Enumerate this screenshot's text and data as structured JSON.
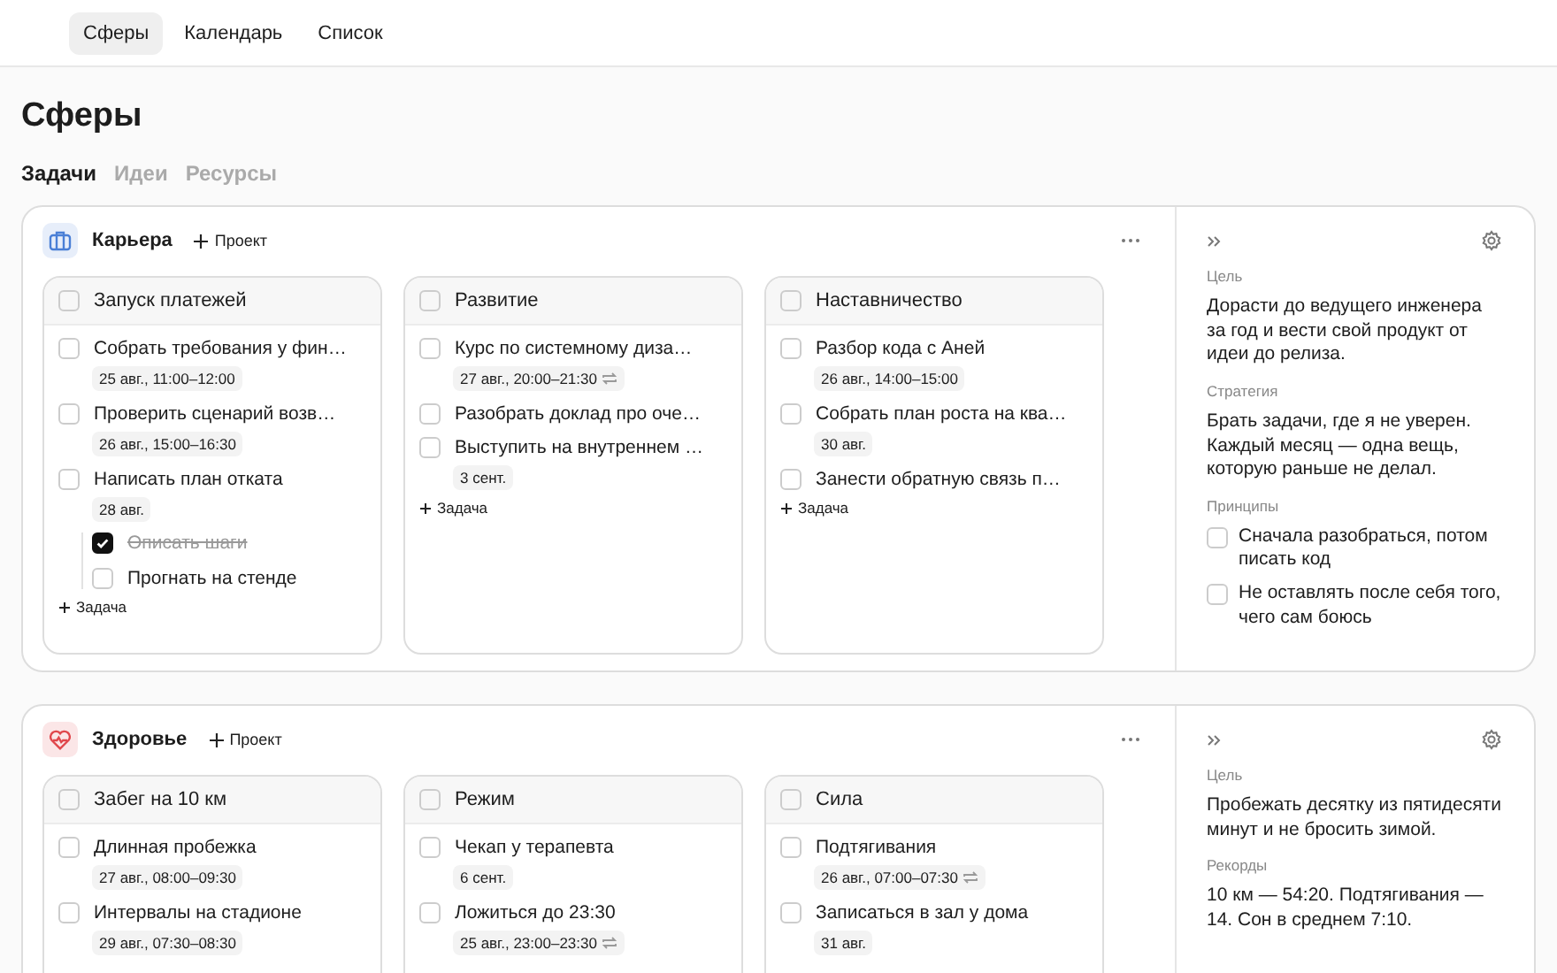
{
  "nav": {
    "tabs": [
      {
        "label": "Сферы",
        "selected": true
      },
      {
        "label": "Календарь",
        "selected": false
      },
      {
        "label": "Список",
        "selected": false
      }
    ]
  },
  "page_title": "Сферы",
  "view_tabs": [
    {
      "label": "Задачи",
      "selected": true
    },
    {
      "label": "Идеи",
      "selected": false
    },
    {
      "label": "Ресурсы",
      "selected": false
    }
  ],
  "spheres": [
    {
      "name": "Карьера",
      "kind": "career",
      "color": "#4a7fd6",
      "add_project": "Проект",
      "projects": [
        {
          "title": "Запуск платежей",
          "checked": false,
          "add_task": "Задача",
          "tasks": [
            {
              "title": "Собрать требования у фин…",
              "checked": false,
              "date": "25 авг., 11:00–12:00",
              "repeat": false
            },
            {
              "title": "Проверить сценарий возв…",
              "checked": false,
              "date": "26 авг., 15:00–16:30",
              "repeat": false
            },
            {
              "title": "Написать план отката",
              "checked": false,
              "date": "28 авг.",
              "repeat": false,
              "children": [
                {
                  "title": "Описать шаги",
                  "checked": true
                },
                {
                  "title": "Прогнать на стенде",
                  "checked": false
                }
              ]
            }
          ]
        },
        {
          "title": "Развитие",
          "checked": false,
          "add_task": "Задача",
          "tasks": [
            {
              "title": "Курс по системному диза…",
              "checked": false,
              "date": "27 авг., 20:00–21:30",
              "repeat": true
            },
            {
              "title": "Разобрать доклад про оче…",
              "checked": false
            },
            {
              "title": "Выступить на внутреннем …",
              "checked": false,
              "date": "3 сент.",
              "repeat": false
            }
          ]
        },
        {
          "title": "Наставничество",
          "checked": false,
          "add_task": "Задача",
          "tasks": [
            {
              "title": "Разбор кода с Аней",
              "checked": false,
              "date": "26 авг., 14:00–15:00",
              "repeat": false
            },
            {
              "title": "Собрать план роста на ква…",
              "checked": false,
              "date": "30 авг.",
              "repeat": false
            },
            {
              "title": "Занести обратную связь п…",
              "checked": false
            }
          ]
        }
      ],
      "panel": [
        {
          "kind": "text",
          "label": "Цель",
          "text": "Дорасти до ведущего инженера за год и вести свой продукт от идеи до релиза."
        },
        {
          "kind": "text",
          "label": "Стратегия",
          "text": "Брать задачи, где я не уверен. Каждый месяц — одна вещь, которую раньше не делал."
        },
        {
          "kind": "checklist",
          "label": "Принципы",
          "items": [
            {
              "text": "Сначала разобраться, потом писать код",
              "checked": false
            },
            {
              "text": "Не оставлять после себя того, чего сам боюсь",
              "checked": false
            }
          ]
        }
      ]
    },
    {
      "name": "Здоровье",
      "kind": "health",
      "color": "#e0474c",
      "add_project": "Проект",
      "projects": [
        {
          "title": "Забег на 10 км",
          "checked": false,
          "tasks": [
            {
              "title": "Длинная пробежка",
              "checked": false,
              "date": "27 авг., 08:00–09:30",
              "repeat": false
            },
            {
              "title": "Интервалы на стадионе",
              "checked": false,
              "date": "29 авг., 07:30–08:30",
              "repeat": false
            }
          ]
        },
        {
          "title": "Режим",
          "checked": false,
          "tasks": [
            {
              "title": "Чекап у терапевта",
              "checked": false,
              "date": "6 сент.",
              "repeat": false
            },
            {
              "title": "Ложиться до 23:30",
              "checked": false,
              "date": "25 авг., 23:00–23:30",
              "repeat": true
            }
          ]
        },
        {
          "title": "Сила",
          "checked": false,
          "tasks": [
            {
              "title": "Подтягивания",
              "checked": false,
              "date": "26 авг., 07:00–07:30",
              "repeat": true
            },
            {
              "title": "Записаться в зал у дома",
              "checked": false,
              "date": "31 авг.",
              "repeat": false
            }
          ]
        }
      ],
      "panel": [
        {
          "kind": "text",
          "label": "Цель",
          "text": "Пробежать десятку из пятидесяти минут и не бросить зимой."
        },
        {
          "kind": "text",
          "label": "Рекорды",
          "text": "10 км — 54:20. Подтягивания — 14. Сон в среднем 7:10."
        }
      ]
    }
  ]
}
